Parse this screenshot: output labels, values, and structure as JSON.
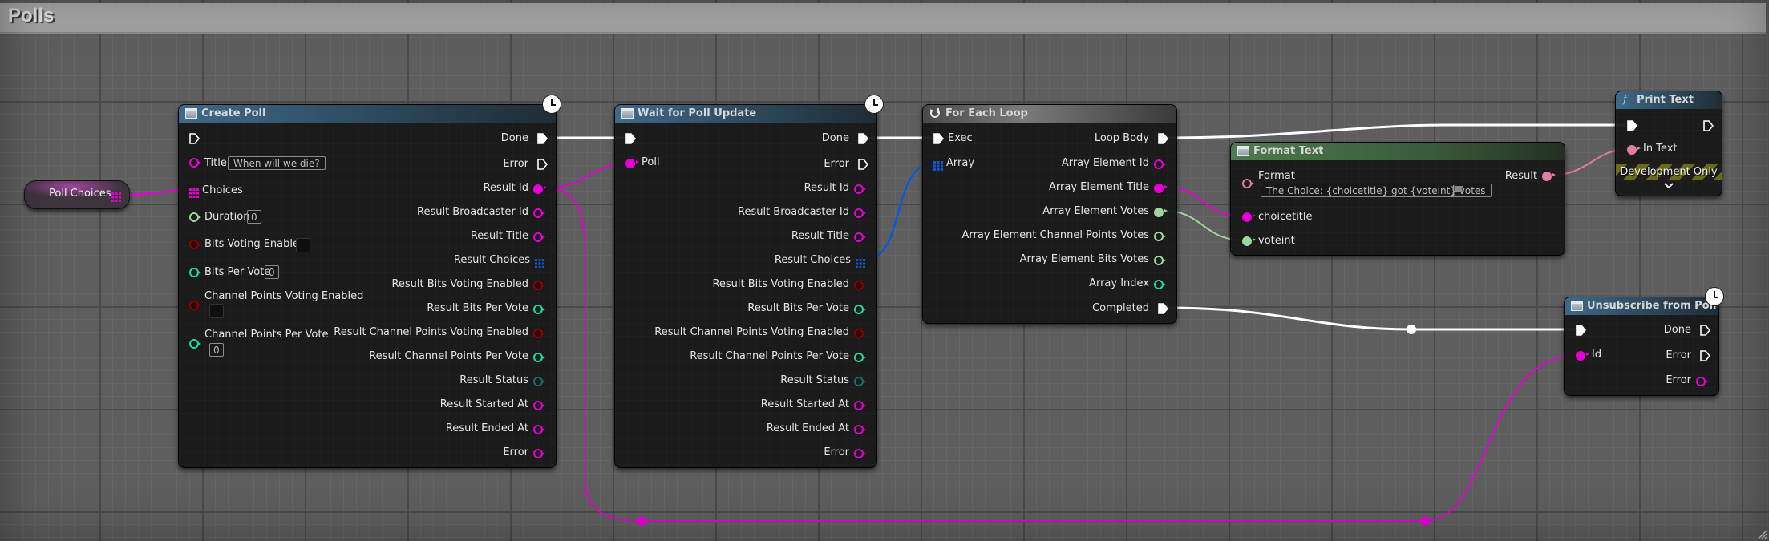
{
  "graph_title": "Polls",
  "colors": {
    "exec": "#ffffff",
    "string_pin": "#e600d6",
    "text_pin": "#e27ba8",
    "int_pin": "#22d6a6",
    "bool_pin": "#8c0000",
    "float_votes": "#9cd69c",
    "struct_array": "#0a5ad8",
    "status_pin": "#15706a"
  },
  "variable": {
    "label": "Poll Choices"
  },
  "create_poll": {
    "title": "Create Poll",
    "inputs": {
      "title_label": "Title",
      "title_value": "When will we die?",
      "choices_label": "Choices",
      "duration_label": "Duration",
      "duration_value": "0",
      "bits_voting_label": "Bits Voting Enabled",
      "bits_per_vote_label": "Bits Per Vote",
      "bits_per_vote_value": "0",
      "cp_voting_label": "Channel Points Voting Enabled",
      "cp_per_vote_label": "Channel Points Per Vote",
      "cp_per_vote_value": "0"
    },
    "outputs": [
      "Done",
      "Error",
      "Result Id",
      "Result Broadcaster Id",
      "Result Title",
      "Result Choices",
      "Result Bits Voting Enabled",
      "Result Bits Per Vote",
      "Result Channel Points Voting Enabled",
      "Result Channel Points Per Vote",
      "Result Status",
      "Result Started At",
      "Result Ended At",
      "Error"
    ]
  },
  "wait_poll": {
    "title": "Wait for Poll Update",
    "poll_label": "Poll",
    "outputs": [
      "Done",
      "Error",
      "Result Id",
      "Result Broadcaster Id",
      "Result Title",
      "Result Choices",
      "Result Bits Voting Enabled",
      "Result Bits Per Vote",
      "Result Channel Points Voting Enabled",
      "Result Channel Points Per Vote",
      "Result Status",
      "Result Started At",
      "Result Ended At",
      "Error"
    ]
  },
  "for_each": {
    "title": "For Each Loop",
    "exec_label": "Exec",
    "array_label": "Array",
    "outputs": [
      "Loop Body",
      "Array Element Id",
      "Array Element Title",
      "Array Element Votes",
      "Array Element Channel Points Votes",
      "Array Element Bits Votes",
      "Array Index",
      "Completed"
    ]
  },
  "format_text": {
    "title": "Format Text",
    "format_label": "Format",
    "format_value": "The Choice: {choicetitle} got {voteint} votes",
    "arg1": "choicetitle",
    "arg2": "voteint",
    "result_label": "Result"
  },
  "print_text": {
    "title": "Print Text",
    "in_text_label": "In Text",
    "dev_only": "Development Only"
  },
  "unsubscribe": {
    "title": "Unsubscribe from Poll",
    "id_label": "Id",
    "outputs": [
      "Done",
      "Error",
      "Error"
    ]
  }
}
